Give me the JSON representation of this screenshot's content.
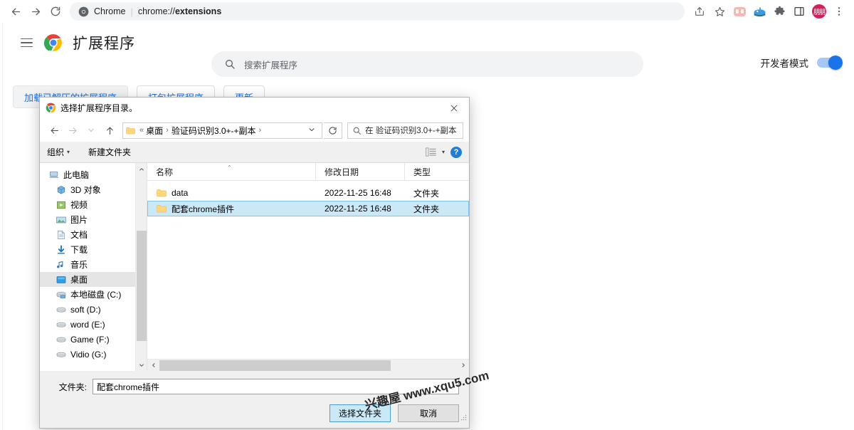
{
  "browser": {
    "back_icon": "arrow-left-icon",
    "forward_icon": "arrow-right-icon",
    "reload_icon": "reload-icon",
    "omnibox": {
      "site_icon": "chrome-icon",
      "site_label": "Chrome",
      "separator": "|",
      "url_scheme": "chrome://",
      "url_path": "extensions"
    },
    "toolbar_icons": [
      {
        "name": "share-icon",
        "label": ""
      },
      {
        "name": "bookmark-star-icon",
        "label": ""
      },
      {
        "name": "extension-pink-icon",
        "label": ""
      },
      {
        "name": "extension-whale-icon",
        "label": ""
      },
      {
        "name": "extensions-puzzle-icon",
        "label": ""
      },
      {
        "name": "side-panel-icon",
        "label": ""
      },
      {
        "name": "profile-avatar",
        "label": "朋朋"
      },
      {
        "name": "browser-menu-icon",
        "label": ""
      }
    ]
  },
  "extensions_page": {
    "menu_icon": "hamburger-menu-icon",
    "logo_icon": "chrome-logo-icon",
    "title": "扩展程序",
    "search": {
      "icon": "search-icon",
      "placeholder": "搜索扩展程序",
      "value": ""
    },
    "dev_mode": {
      "label": "开发者模式",
      "enabled": true,
      "accent_color": "#1a73e8"
    },
    "buttons": [
      {
        "label": "加载已解压的扩展程序",
        "active": true
      },
      {
        "label": "打包扩展程序",
        "active": false
      },
      {
        "label": "更新",
        "active": false
      }
    ]
  },
  "dialog": {
    "title_icon": "chrome-icon",
    "title": "选择扩展程序目录。",
    "close_icon": "close-icon",
    "nav": {
      "back_icon": "arrow-left-icon",
      "forward_icon": "arrow-right-icon",
      "recent_icon": "chevron-down-icon",
      "up_icon": "arrow-up-icon",
      "crumb_icon": "folder-icon",
      "crumbs": [
        "桌面",
        "验证码识别3.0+-+副本"
      ],
      "crumb_separator": "›",
      "dropdown_icon": "chevron-down-icon",
      "refresh_icon": "refresh-icon",
      "search": {
        "icon": "search-icon",
        "placeholder": "在 验证码识别3.0+-+副本 ...",
        "value": ""
      }
    },
    "toolbar": {
      "organize_label": "组织",
      "organize_caret": "▾",
      "new_folder_label": "新建文件夹",
      "view_icon": "view-mode-icon",
      "view_caret": "▾",
      "help_icon": "help-icon",
      "help_glyph": "?"
    },
    "tree": [
      {
        "label": "此电脑",
        "icon": "this-pc-icon",
        "indent": false,
        "selected": false
      },
      {
        "label": "3D 对象",
        "icon": "3d-objects-icon",
        "indent": true,
        "selected": false
      },
      {
        "label": "视频",
        "icon": "videos-icon",
        "indent": true,
        "selected": false
      },
      {
        "label": "图片",
        "icon": "pictures-icon",
        "indent": true,
        "selected": false
      },
      {
        "label": "文档",
        "icon": "documents-icon",
        "indent": true,
        "selected": false
      },
      {
        "label": "下载",
        "icon": "downloads-icon",
        "indent": true,
        "selected": false
      },
      {
        "label": "音乐",
        "icon": "music-icon",
        "indent": true,
        "selected": false
      },
      {
        "label": "桌面",
        "icon": "desktop-icon",
        "indent": true,
        "selected": true
      },
      {
        "label": "本地磁盘 (C:)",
        "icon": "system-drive-icon",
        "indent": true,
        "selected": false
      },
      {
        "label": "soft (D:)",
        "icon": "drive-icon",
        "indent": true,
        "selected": false
      },
      {
        "label": "word (E:)",
        "icon": "drive-icon",
        "indent": true,
        "selected": false
      },
      {
        "label": "Game (F:)",
        "icon": "drive-icon",
        "indent": true,
        "selected": false
      },
      {
        "label": "Vidio (G:)",
        "icon": "drive-icon",
        "indent": true,
        "selected": false
      }
    ],
    "columns": [
      {
        "label": "名称",
        "sort_caret": "⌃"
      },
      {
        "label": "修改日期",
        "sort_caret": ""
      },
      {
        "label": "类型",
        "sort_caret": ""
      }
    ],
    "rows": [
      {
        "icon": "folder-icon",
        "name": "data",
        "date": "2022-11-25 16:48",
        "type": "文件夹",
        "selected": false
      },
      {
        "icon": "folder-icon",
        "name": "配套chrome插件",
        "date": "2022-11-25 16:48",
        "type": "文件夹",
        "selected": true
      }
    ],
    "hscroll": {
      "left_icon": "chevron-left-icon",
      "right_icon": "chevron-right-icon"
    },
    "footer": {
      "folder_label": "文件夹:",
      "folder_value": "配套chrome插件",
      "select_button": "选择文件夹",
      "cancel_button": "取消"
    }
  },
  "watermark": {
    "text": "兴趣屋 www.xqu5.com"
  }
}
